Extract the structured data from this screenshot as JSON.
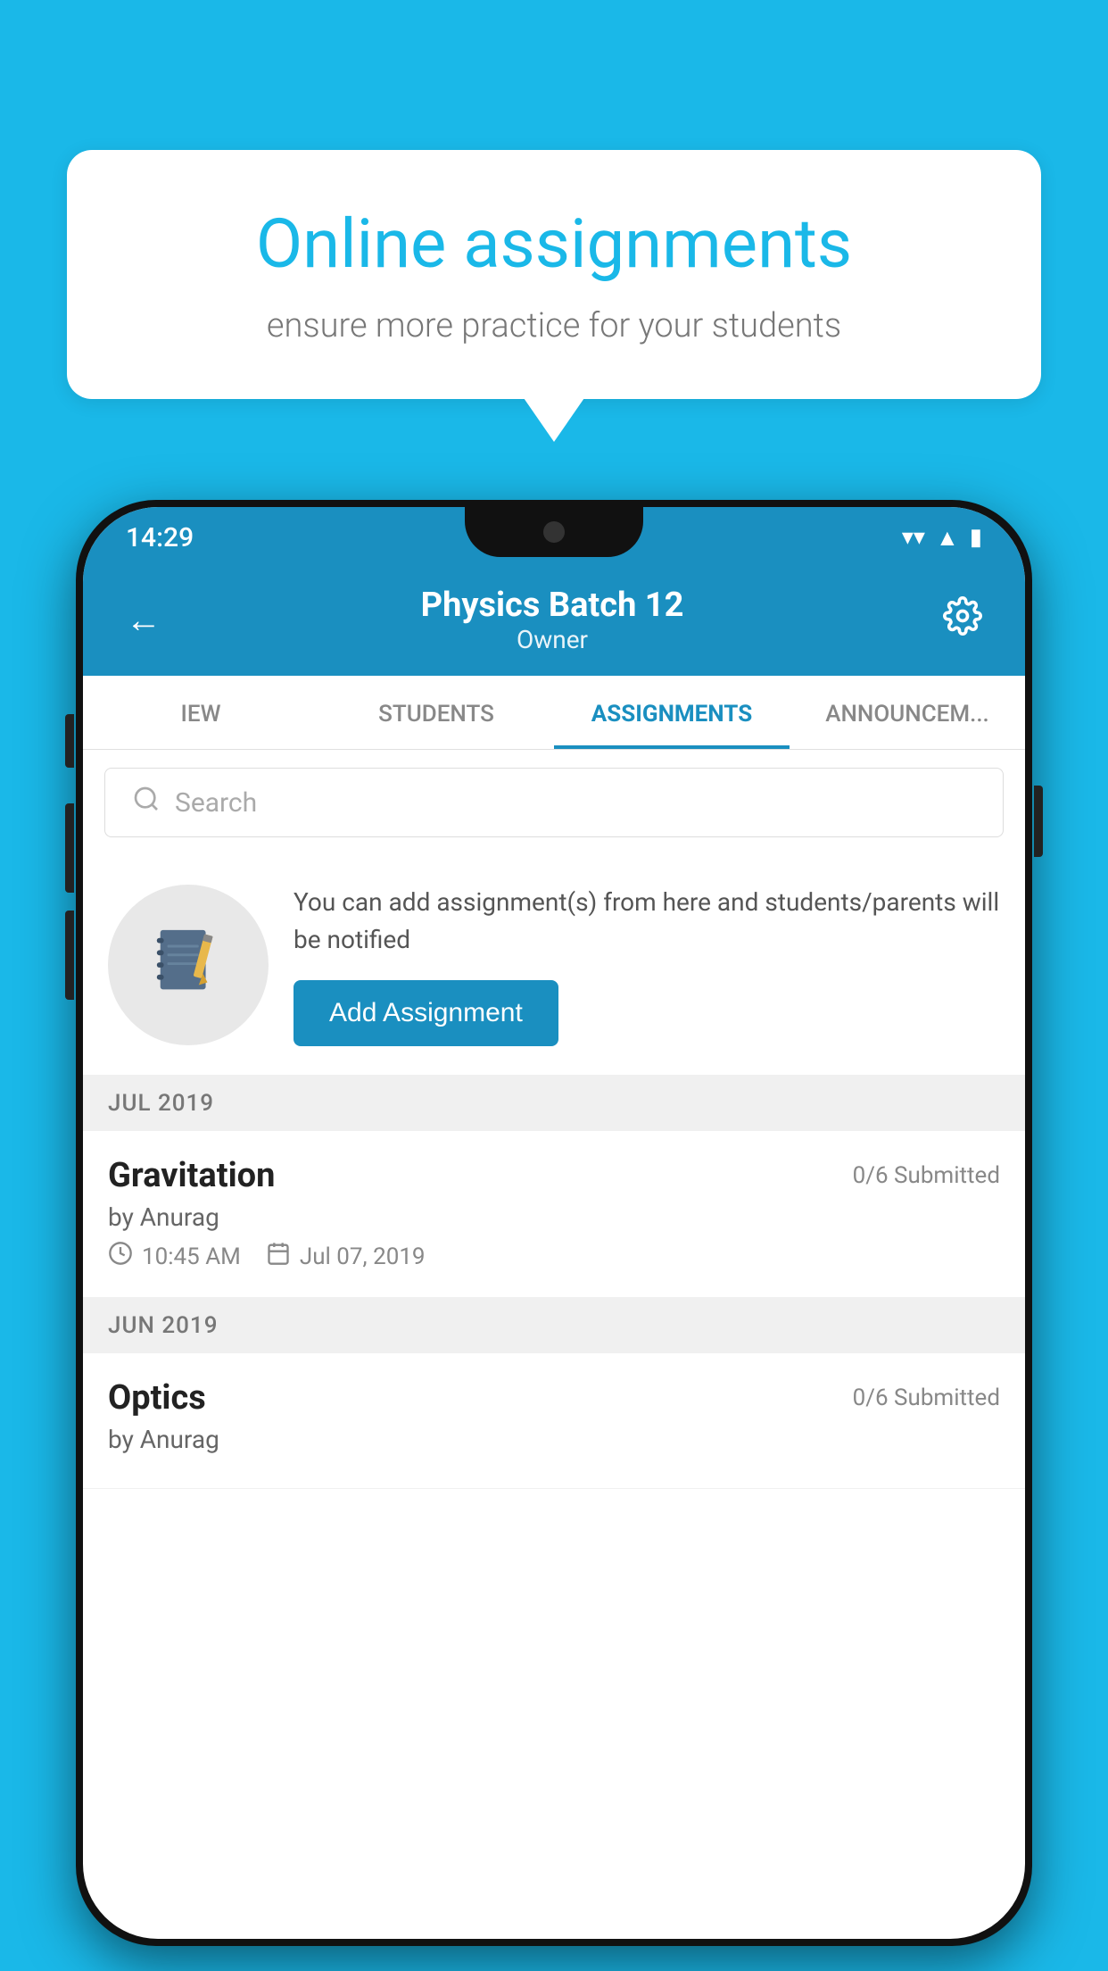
{
  "background_color": "#1ab8e8",
  "speech_bubble": {
    "title": "Online assignments",
    "subtitle": "ensure more practice for your students"
  },
  "phone": {
    "status_bar": {
      "time": "14:29",
      "wifi": "▼",
      "signal": "▲",
      "battery": "▮"
    },
    "header": {
      "title": "Physics Batch 12",
      "subtitle": "Owner",
      "back_label": "←",
      "settings_label": "⚙"
    },
    "tabs": [
      {
        "label": "IEW",
        "active": false
      },
      {
        "label": "STUDENTS",
        "active": false
      },
      {
        "label": "ASSIGNMENTS",
        "active": true
      },
      {
        "label": "ANNOUNCEM...",
        "active": false
      }
    ],
    "search": {
      "placeholder": "Search"
    },
    "promo": {
      "text": "You can add assignment(s) from here and students/parents will be notified",
      "button_label": "Add Assignment"
    },
    "sections": [
      {
        "month": "JUL 2019",
        "assignments": [
          {
            "name": "Gravitation",
            "submitted": "0/6 Submitted",
            "by": "by Anurag",
            "time": "10:45 AM",
            "date": "Jul 07, 2019"
          }
        ]
      },
      {
        "month": "JUN 2019",
        "assignments": [
          {
            "name": "Optics",
            "submitted": "0/6 Submitted",
            "by": "by Anurag",
            "time": "",
            "date": ""
          }
        ]
      }
    ]
  }
}
